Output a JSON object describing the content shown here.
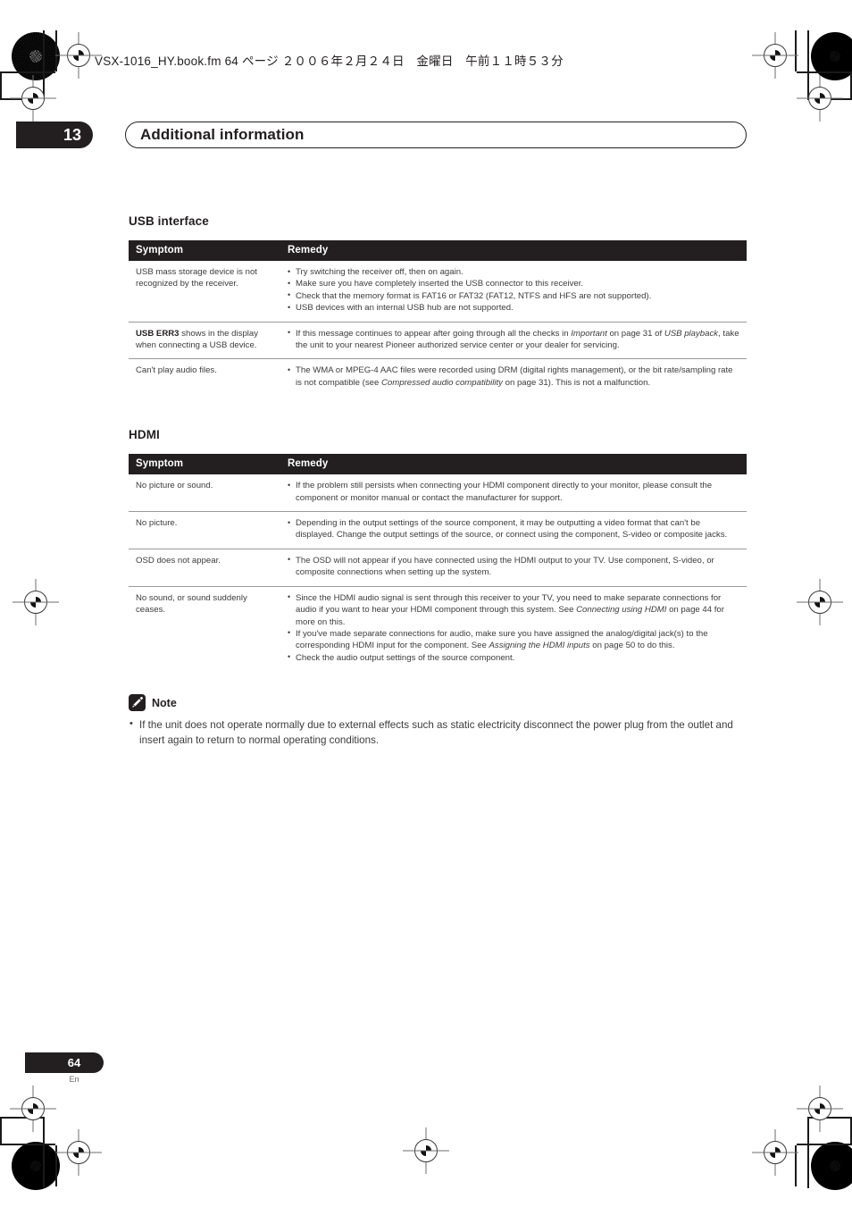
{
  "running_head": "VSX-1016_HY.book.fm 64 ページ ２００６年２月２４日　金曜日　午前１１時５３分",
  "chapter": {
    "number": "13",
    "title": "Additional information"
  },
  "sections": [
    {
      "heading": "USB interface",
      "columns": [
        "Symptom",
        "Remedy"
      ],
      "rows": [
        {
          "symptom": "USB mass storage device is not recognized by the receiver.",
          "remedies": [
            "Try switching the receiver off, then on again.",
            "Make sure you have completely inserted the USB connector to this receiver.",
            "Check that the memory format is FAT16 or FAT32 (FAT12, NTFS and HFS are not supported).",
            "USB devices with an internal USB hub are not supported."
          ]
        },
        {
          "symptom_bold": "USB ERR3",
          "symptom": " shows in the display when connecting a USB device.",
          "remedies_rich": [
            "If this message continues to appear after going through all the checks in <i>Important</i> on page 31 of <i>USB playback</i>, take the unit to your nearest Pioneer authorized service center or your dealer for servicing."
          ]
        },
        {
          "symptom": "Can't play audio files.",
          "remedies_rich": [
            "The WMA or MPEG-4 AAC files were recorded using DRM (digital rights management), or the bit rate/sampling rate is not compatible (see <i>Compressed audio compatibility</i> on page 31). This is not a malfunction."
          ]
        }
      ]
    },
    {
      "heading": "HDMI",
      "columns": [
        "Symptom",
        "Remedy"
      ],
      "rows": [
        {
          "symptom": "No picture or sound.",
          "remedies": [
            "If the problem still persists when connecting your HDMI component directly to your monitor, please consult the component or monitor manual or contact the manufacturer for support."
          ]
        },
        {
          "symptom": "No picture.",
          "remedies": [
            "Depending in the output settings of the source component, it may be outputting a video format that can't be displayed. Change the output settings of the source, or connect using the component, S-video or composite jacks."
          ]
        },
        {
          "symptom": "OSD does not appear.",
          "remedies": [
            "The OSD will not appear if you have connected using the HDMI output to your TV. Use component, S-video, or composite connections when setting up the system."
          ]
        },
        {
          "symptom": "No sound, or sound suddenly ceases.",
          "remedies_rich": [
            "Since the HDMI audio signal is sent through this receiver to your TV, you need to make separate connections for audio if you want to hear your HDMI component through this system. See <i>Connecting using HDMI</i> on page 44 for more on this.",
            "If you've made separate connections for audio, make sure you have assigned the analog/digital jack(s) to the corresponding HDMI input for the component. See <i>Assigning the HDMI inputs</i> on page 50 to do this.",
            "Check the audio output settings of the source component."
          ]
        }
      ]
    }
  ],
  "note": {
    "icon": "pencil-icon",
    "label": "Note",
    "items": [
      "If the unit does not operate normally due to external effects such as static electricity disconnect the power plug from the outlet and insert again to return to normal operating conditions."
    ]
  },
  "footer": {
    "page_number": "64",
    "language": "En"
  },
  "colors": {
    "ink": "#231f20",
    "body_text": "#3c3c3c",
    "rule": "#9a9a9a"
  }
}
